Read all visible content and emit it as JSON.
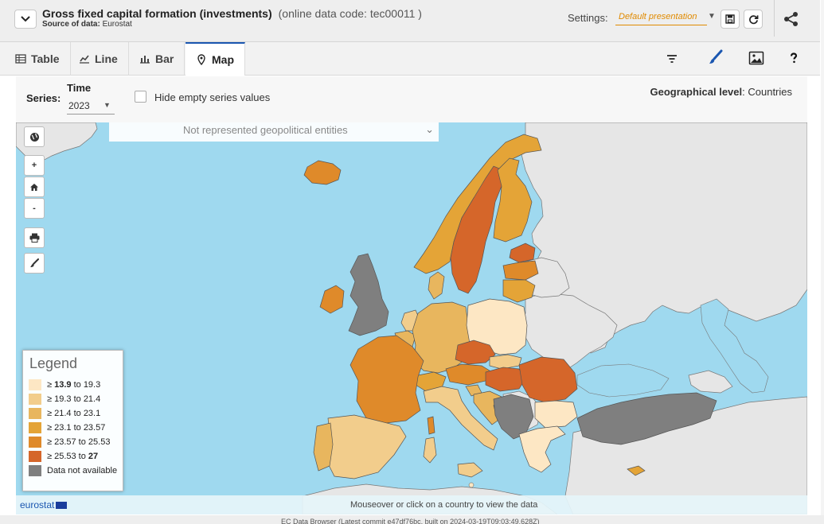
{
  "header": {
    "title": "Gross fixed capital formation (investments)",
    "code": "(online data code: tec00011 )",
    "source_label": "Source of data:",
    "source_value": "Eurostat",
    "settings_label": "Settings:",
    "settings_value": "Default presentation"
  },
  "tabs": [
    {
      "label": "Table",
      "icon": "table-icon"
    },
    {
      "label": "Line",
      "icon": "line-chart-icon"
    },
    {
      "label": "Bar",
      "icon": "bar-chart-icon"
    },
    {
      "label": "Map",
      "icon": "map-pin-icon",
      "active": true
    }
  ],
  "series": {
    "series_label": "Series:",
    "time_label": "Time",
    "time_value": "2023",
    "hide_empty_label": "Hide empty series values",
    "geo_label": "Geographical level",
    "geo_value": "Countries"
  },
  "map": {
    "not_represented": "Not represented geopolitical entities",
    "controls": [
      "+",
      "-"
    ],
    "legend": {
      "title": "Legend",
      "items": [
        {
          "prefix": "≥ ",
          "low": "13.9",
          "mid": " to ",
          "high": "19.3",
          "color": "#fde7c4",
          "bold_low": true,
          "bold_high": false
        },
        {
          "prefix": "≥ ",
          "low": "19.3",
          "mid": " to ",
          "high": "21.4",
          "color": "#f2cd8c",
          "bold_low": false,
          "bold_high": false
        },
        {
          "prefix": "≥ ",
          "low": "21.4",
          "mid": " to ",
          "high": "23.1",
          "color": "#e8b65e",
          "bold_low": false,
          "bold_high": false
        },
        {
          "prefix": "≥ ",
          "low": "23.1",
          "mid": " to ",
          "high": "23.57",
          "color": "#e4a437",
          "bold_low": false,
          "bold_high": false
        },
        {
          "prefix": "≥ ",
          "low": "23.57",
          "mid": " to ",
          "high": "25.53",
          "color": "#df8a2a",
          "bold_low": false,
          "bold_high": false
        },
        {
          "prefix": "≥ ",
          "low": "25.53",
          "mid": " to ",
          "high": "27",
          "color": "#d5662a",
          "bold_low": false,
          "bold_high": true
        },
        {
          "prefix": "",
          "low": "",
          "mid": "Data not available",
          "high": "",
          "color": "#7f7f7f",
          "bold_low": false,
          "bold_high": false
        }
      ]
    },
    "logo_text": "eurostat",
    "hint": "Mouseover or click on a country to view the data"
  },
  "footer": {
    "build": "EC Data Browser (Latest commit e47df76bc, built on 2024-03-19T09:03:49.628Z)"
  },
  "colors": {
    "sea": "#9fd9ef",
    "non_eu_land": "#e6e6e6",
    "accent": "#e08a00",
    "active_tab": "#1a56b0"
  }
}
